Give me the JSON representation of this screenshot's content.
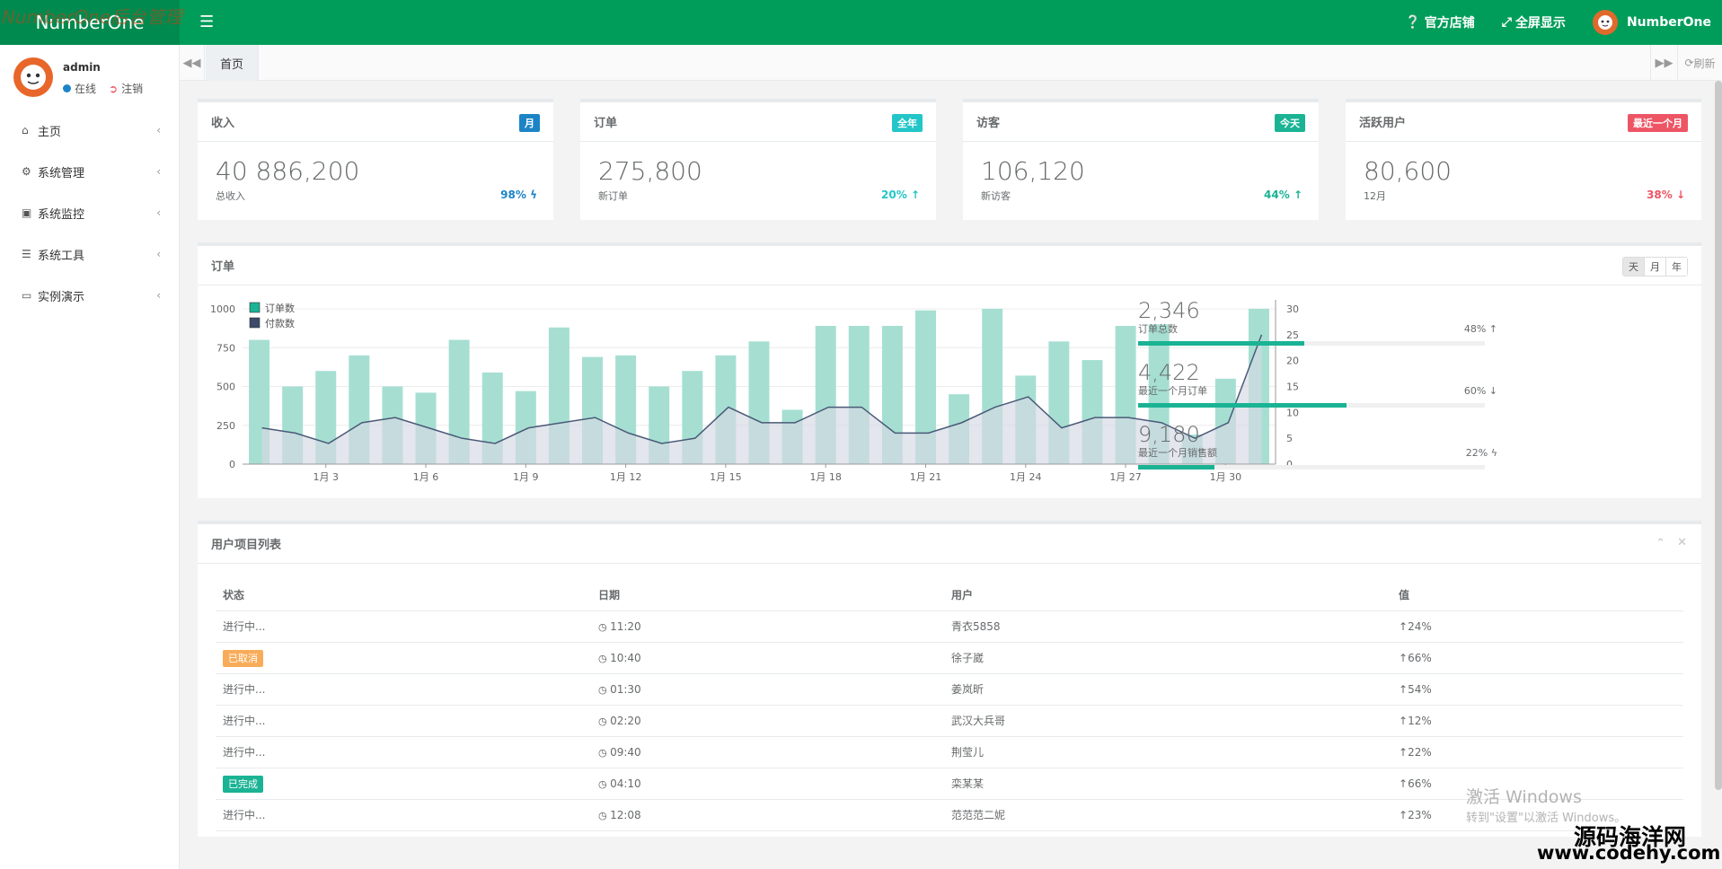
{
  "app": {
    "logo": "NumberOne",
    "overlay_watermark": "NumberOne后台管理"
  },
  "topbar": {
    "store": "官方店铺",
    "fullscreen": "全屏显示",
    "username": "NumberOne"
  },
  "user": {
    "name": "admin",
    "status": "在线",
    "logout": "注销"
  },
  "sidebar": {
    "items": [
      {
        "label": "主页",
        "icon": "home-icon"
      },
      {
        "label": "系统管理",
        "icon": "gear-icon"
      },
      {
        "label": "系统监控",
        "icon": "video-icon"
      },
      {
        "label": "系统工具",
        "icon": "list-icon"
      },
      {
        "label": "实例演示",
        "icon": "desktop-icon"
      }
    ]
  },
  "tabs": {
    "home": "首页",
    "refresh": "刷新"
  },
  "stats": [
    {
      "title": "收入",
      "badge": "月",
      "badge_color": "#1c84c6",
      "value": "40 886,200",
      "sub": "总收入",
      "pct": "98%",
      "pct_color": "#1c84c6",
      "arrow": "ϟ"
    },
    {
      "title": "订单",
      "badge": "全年",
      "badge_color": "#23c6c8",
      "value": "275,800",
      "sub": "新订单",
      "pct": "20%",
      "pct_color": "#23c6c8",
      "arrow": "↑"
    },
    {
      "title": "访客",
      "badge": "今天",
      "badge_color": "#1ab394",
      "value": "106,120",
      "sub": "新访客",
      "pct": "44%",
      "pct_color": "#1ab394",
      "arrow": "↑"
    },
    {
      "title": "活跃用户",
      "badge": "最近一个月",
      "badge_color": "#ed5565",
      "value": "80,600",
      "sub": "12月",
      "pct": "38%",
      "pct_color": "#ed5565",
      "arrow": "↓"
    }
  ],
  "orders_panel": {
    "title": "订单",
    "time_buttons": [
      "天",
      "月",
      "年"
    ],
    "mini_stats": [
      {
        "value": "2,346",
        "label": "订单总数",
        "pct": "48%",
        "arrow": "↑",
        "fill": 0.48
      },
      {
        "value": "4,422",
        "label": "最近一个月订单",
        "pct": "60%",
        "arrow": "↓",
        "fill": 0.6
      },
      {
        "value": "9,180",
        "label": "最近一个月销售额",
        "pct": "22%",
        "arrow": "ϟ",
        "fill": 0.22
      }
    ]
  },
  "chart_data": {
    "type": "bar",
    "series": [
      {
        "name": "订单数",
        "type": "bar",
        "axis": "left",
        "values": [
          800,
          500,
          600,
          700,
          500,
          460,
          800,
          590,
          470,
          880,
          690,
          700,
          500,
          600,
          700,
          790,
          350,
          890,
          890,
          890,
          990,
          450,
          1000,
          570,
          790,
          670,
          890,
          900,
          190,
          550,
          1000
        ]
      },
      {
        "name": "付款数",
        "type": "area",
        "axis": "right",
        "values": [
          7,
          6,
          4,
          8,
          9,
          7,
          5,
          4,
          7,
          8,
          9,
          6,
          4,
          5,
          11,
          8,
          8,
          11,
          11,
          6,
          6,
          8,
          11,
          13,
          7,
          9,
          9,
          8,
          5,
          8,
          25
        ]
      }
    ],
    "x_ticks": [
      "1月 3",
      "1月 6",
      "1月 9",
      "1月 12",
      "1月 15",
      "1月 18",
      "1月 21",
      "1月 24",
      "1月 27",
      "1月 30"
    ],
    "y_left_ticks": [
      "0",
      "250",
      "500",
      "750",
      "1000"
    ],
    "y_right_ticks": [
      "0",
      "5",
      "10",
      "15",
      "20",
      "25",
      "30"
    ],
    "ylim_left": [
      0,
      1000
    ],
    "ylim_right": [
      0,
      30
    ],
    "colors": {
      "bar": "#a6dfd2",
      "area": "#d6d8e4",
      "line": "#4a5a78",
      "legend_bar": "#1ab394",
      "legend_line": "#3c4a6b"
    }
  },
  "table_panel": {
    "title": "用户项目列表",
    "headers": [
      "状态",
      "日期",
      "用户",
      "值"
    ],
    "rows": [
      {
        "status": "进行中...",
        "status_type": "text",
        "time": "11:20",
        "user": "青衣5858",
        "value": "24%"
      },
      {
        "status": "已取消",
        "status_type": "warning",
        "time": "10:40",
        "user": "徐子崴",
        "value": "66%"
      },
      {
        "status": "进行中...",
        "status_type": "text",
        "time": "01:30",
        "user": "姜岚昕",
        "value": "54%"
      },
      {
        "status": "进行中...",
        "status_type": "text",
        "time": "02:20",
        "user": "武汉大兵哥",
        "value": "12%"
      },
      {
        "status": "进行中...",
        "status_type": "text",
        "time": "09:40",
        "user": "荆莹儿",
        "value": "22%"
      },
      {
        "status": "已完成",
        "status_type": "success",
        "time": "04:10",
        "user": "栾某某",
        "value": "66%"
      },
      {
        "status": "进行中...",
        "status_type": "text",
        "time": "12:08",
        "user": "范范范二妮",
        "value": "23%"
      }
    ]
  },
  "watermarks": {
    "win1": "激活 Windows",
    "win2": "转到\"设置\"以激活 Windows。",
    "site1": "源码海洋网",
    "site2": "www.codehy.com"
  }
}
